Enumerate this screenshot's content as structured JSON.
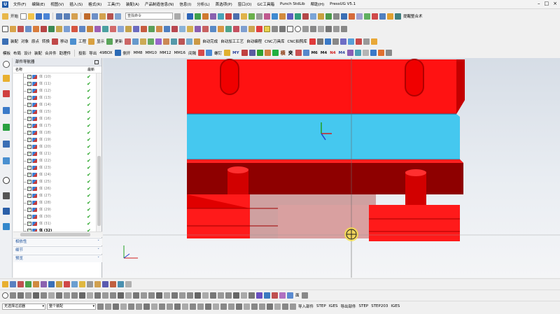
{
  "menu": {
    "logo": "U",
    "items": [
      "文件(F)",
      "编辑(E)",
      "视图(V)",
      "插入(S)",
      "格式(R)",
      "工具(T)",
      "装配(A)",
      "产品制造信息(N)",
      "信息(I)",
      "分析(L)",
      "首选项(P)",
      "窗口(O)",
      "GC工具箱",
      "Punch StdLib",
      "帮助(H)",
      "PressUG V5.1"
    ]
  },
  "toolbar1": {
    "start_label": "开始",
    "search_placeholder": "查找命令",
    "right_label": "提醒整合术"
  },
  "toolbar3": {
    "labels": [
      "装配",
      "对象",
      "原点",
      "转换",
      "移动",
      "工程",
      "显示",
      "更新",
      "自动完成",
      "自动加工工艺",
      "自动编程",
      "CNC刀具库",
      "CNC拍照库"
    ]
  },
  "toolbar4": {
    "labels": [
      "模板",
      "布局",
      "设计",
      "装配",
      "合并件",
      "助理件",
      "投影",
      "导出",
      "49BOX",
      "侧开",
      "MM8",
      "MM10",
      "MM12",
      "MM16",
      "间隔",
      "螺钉",
      "M6",
      "M4",
      "N4",
      "M4"
    ],
    "big_chars": [
      "横",
      "夹",
      "MY",
      "M4"
    ]
  },
  "navigator": {
    "title": "部件导航器",
    "col_name": "名称",
    "col_latest": "最新",
    "rows": [
      {
        "label": "体 (10)",
        "bold": false
      },
      {
        "label": "体 (11)",
        "bold": false
      },
      {
        "label": "体 (12)",
        "bold": false
      },
      {
        "label": "体 (13)",
        "bold": false
      },
      {
        "label": "体 (14)",
        "bold": false
      },
      {
        "label": "体 (15)",
        "bold": false
      },
      {
        "label": "体 (16)",
        "bold": false
      },
      {
        "label": "体 (17)",
        "bold": false
      },
      {
        "label": "体 (18)",
        "bold": false
      },
      {
        "label": "体 (19)",
        "bold": false
      },
      {
        "label": "体 (20)",
        "bold": false
      },
      {
        "label": "体 (21)",
        "bold": false
      },
      {
        "label": "体 (22)",
        "bold": false
      },
      {
        "label": "体 (23)",
        "bold": false
      },
      {
        "label": "体 (24)",
        "bold": false
      },
      {
        "label": "体 (25)",
        "bold": false
      },
      {
        "label": "体 (26)",
        "bold": false
      },
      {
        "label": "体 (27)",
        "bold": false
      },
      {
        "label": "体 (28)",
        "bold": false
      },
      {
        "label": "体 (29)",
        "bold": false
      },
      {
        "label": "体 (30)",
        "bold": false
      },
      {
        "label": "体 (31)",
        "bold": false
      },
      {
        "label": "体 (32)",
        "bold": true
      }
    ],
    "sections": [
      "相依性",
      "细节",
      "预览"
    ]
  },
  "bottom": {
    "labels_right": [
      "面",
      "导入部件",
      "STEP",
      "IGES",
      "导出部件",
      "STEP",
      "STEP203",
      "IGES"
    ],
    "filter_combo": "无选择过滤器",
    "assembly_combo": "整个装配"
  },
  "colors": {
    "red": "#ff1a1a",
    "dark_red": "#8e0000",
    "blue": "#45c8ef",
    "pink": "#d9a0a0",
    "check": "#1fa21f"
  }
}
